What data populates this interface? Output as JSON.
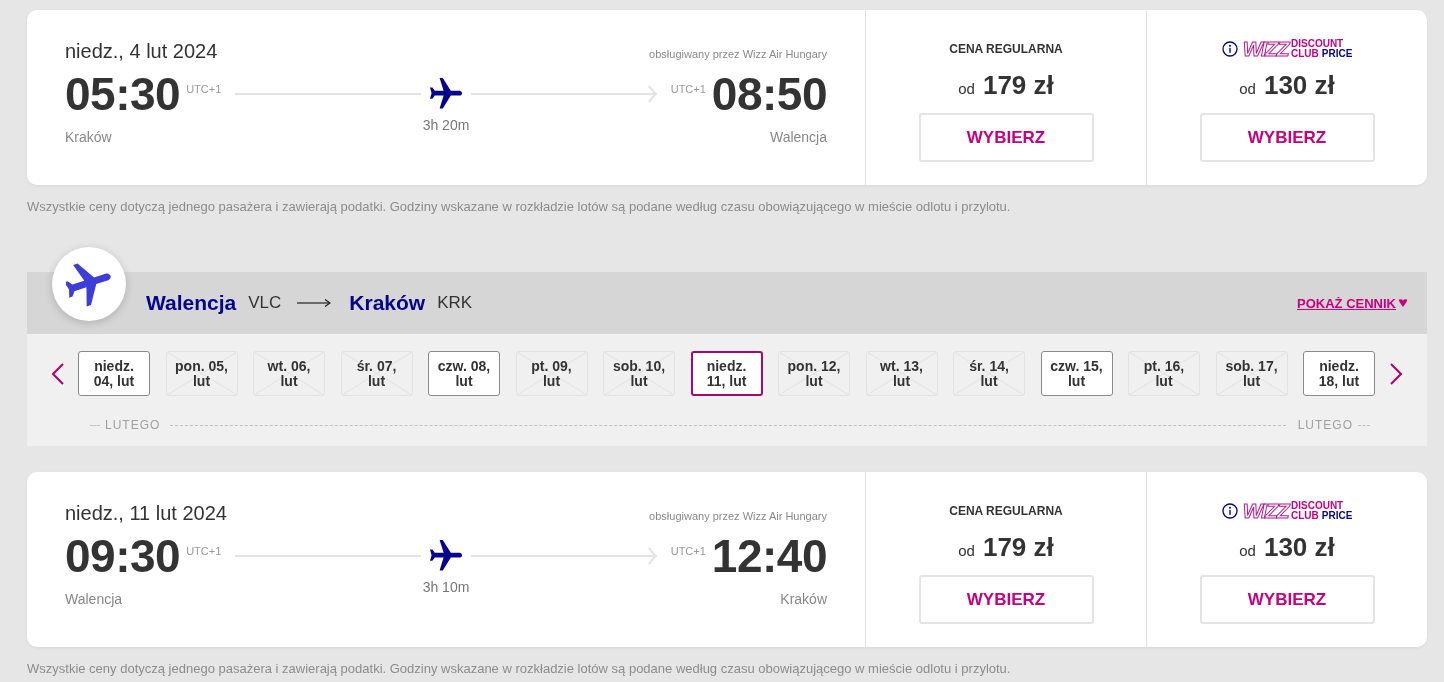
{
  "outbound": {
    "flight": {
      "date": "niedz., 4 lut 2024",
      "operator": "obsługiwany przez Wizz Air Hungary",
      "departure": {
        "time": "05:30",
        "timezone": "UTC+1",
        "city": "Kraków"
      },
      "duration": "3h 20m",
      "arrival": {
        "time": "08:50",
        "timezone": "UTC+1",
        "city": "Walencja"
      },
      "fares": [
        {
          "kind": "regular",
          "label": "CENA REGULARNA",
          "prefix": "od",
          "price": "179 zł",
          "button": "WYBIERZ"
        },
        {
          "kind": "club",
          "logo": {
            "brand": "WIZZ",
            "line_1": "DISCOUNT",
            "line_2": "CLUB",
            "line_2_accent": "PRICE"
          },
          "prefix": "od",
          "price": "130 zł",
          "button": "WYBIERZ"
        }
      ]
    },
    "disclaimer": "Wszystkie ceny dotyczą jednego pasażera i zawierają podatki. Godziny wskazane w rozkładzie lotów są podane według czasu obowiązującego w mieście odlotu i przylotu."
  },
  "return": {
    "route": {
      "from": {
        "city": "Walencja",
        "code": "VLC"
      },
      "to": {
        "city": "Kraków",
        "code": "KRK"
      },
      "price_toggle": "POKAŻ CENNIK"
    },
    "date_tabs": [
      {
        "lines": [
          "niedz.",
          "04, lut"
        ],
        "available": true,
        "selected": false
      },
      {
        "lines": [
          "pon. 05,",
          "lut"
        ],
        "available": false,
        "selected": false
      },
      {
        "lines": [
          "wt. 06,",
          "lut"
        ],
        "available": false,
        "selected": false
      },
      {
        "lines": [
          "śr. 07,",
          "lut"
        ],
        "available": false,
        "selected": false
      },
      {
        "lines": [
          "czw. 08,",
          "lut"
        ],
        "available": true,
        "selected": false
      },
      {
        "lines": [
          "pt. 09,",
          "lut"
        ],
        "available": false,
        "selected": false
      },
      {
        "lines": [
          "sob. 10,",
          "lut"
        ],
        "available": false,
        "selected": false
      },
      {
        "lines": [
          "niedz.",
          "11, lut"
        ],
        "available": true,
        "selected": true
      },
      {
        "lines": [
          "pon. 12,",
          "lut"
        ],
        "available": false,
        "selected": false
      },
      {
        "lines": [
          "wt. 13,",
          "lut"
        ],
        "available": false,
        "selected": false
      },
      {
        "lines": [
          "śr. 14,",
          "lut"
        ],
        "available": false,
        "selected": false
      },
      {
        "lines": [
          "czw. 15,",
          "lut"
        ],
        "available": true,
        "selected": false
      },
      {
        "lines": [
          "pt. 16,",
          "lut"
        ],
        "available": false,
        "selected": false
      },
      {
        "lines": [
          "sob. 17,",
          "lut"
        ],
        "available": false,
        "selected": false
      },
      {
        "lines": [
          "niedz.",
          "18, lut"
        ],
        "available": true,
        "selected": false
      }
    ],
    "month_labels": [
      "LUTEGO",
      "LUTEGO"
    ],
    "flight": {
      "date": "niedz., 11 lut 2024",
      "operator": "obsługiwany przez Wizz Air Hungary",
      "departure": {
        "time": "09:30",
        "timezone": "UTC+1",
        "city": "Walencja"
      },
      "duration": "3h 10m",
      "arrival": {
        "time": "12:40",
        "timezone": "UTC+1",
        "city": "Kraków"
      },
      "fares": [
        {
          "kind": "regular",
          "label": "CENA REGULARNA",
          "prefix": "od",
          "price": "179 zł",
          "button": "WYBIERZ"
        },
        {
          "kind": "club",
          "logo": {
            "brand": "WIZZ",
            "line_1": "DISCOUNT",
            "line_2": "CLUB",
            "line_2_accent": "PRICE"
          },
          "prefix": "od",
          "price": "130 zł",
          "button": "WYBIERZ"
        }
      ]
    },
    "disclaimer": "Wszystkie ceny dotyczą jednego pasażera i zawierają podatki. Godziny wskazane w rozkładzie lotów są podane według czasu obowiązującego w mieście odlotu i przylotu."
  }
}
